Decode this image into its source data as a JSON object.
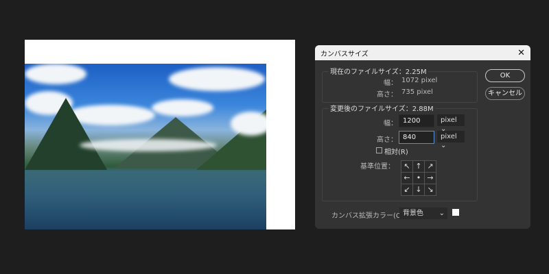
{
  "dialog": {
    "title": "カンバスサイズ",
    "close_icon": "close-icon",
    "current": {
      "label": "現在のファイルサイズ：2.25M",
      "width_label": "幅：",
      "width_value": "1072 pixel",
      "height_label": "高さ：",
      "height_value": "735 pixel"
    },
    "new": {
      "label": "変更後のファイルサイズ：2.88M",
      "width_label": "幅：",
      "width_value": "1200",
      "width_unit": "pixel",
      "height_label": "高さ：",
      "height_value": "840",
      "height_unit": "pixel",
      "relative_label": "相対(R)",
      "anchor_label": "基準位置："
    },
    "anchor_arrows": [
      "↖",
      "↑",
      "↗",
      "←",
      "•",
      "→",
      "↙",
      "↓",
      "↘"
    ],
    "ok_label": "OK",
    "cancel_label": "キャンセル",
    "extension_color_label": "カンバス拡張カラー(C)：",
    "extension_color_value": "背景色",
    "swatch_color": "#ffffff"
  }
}
